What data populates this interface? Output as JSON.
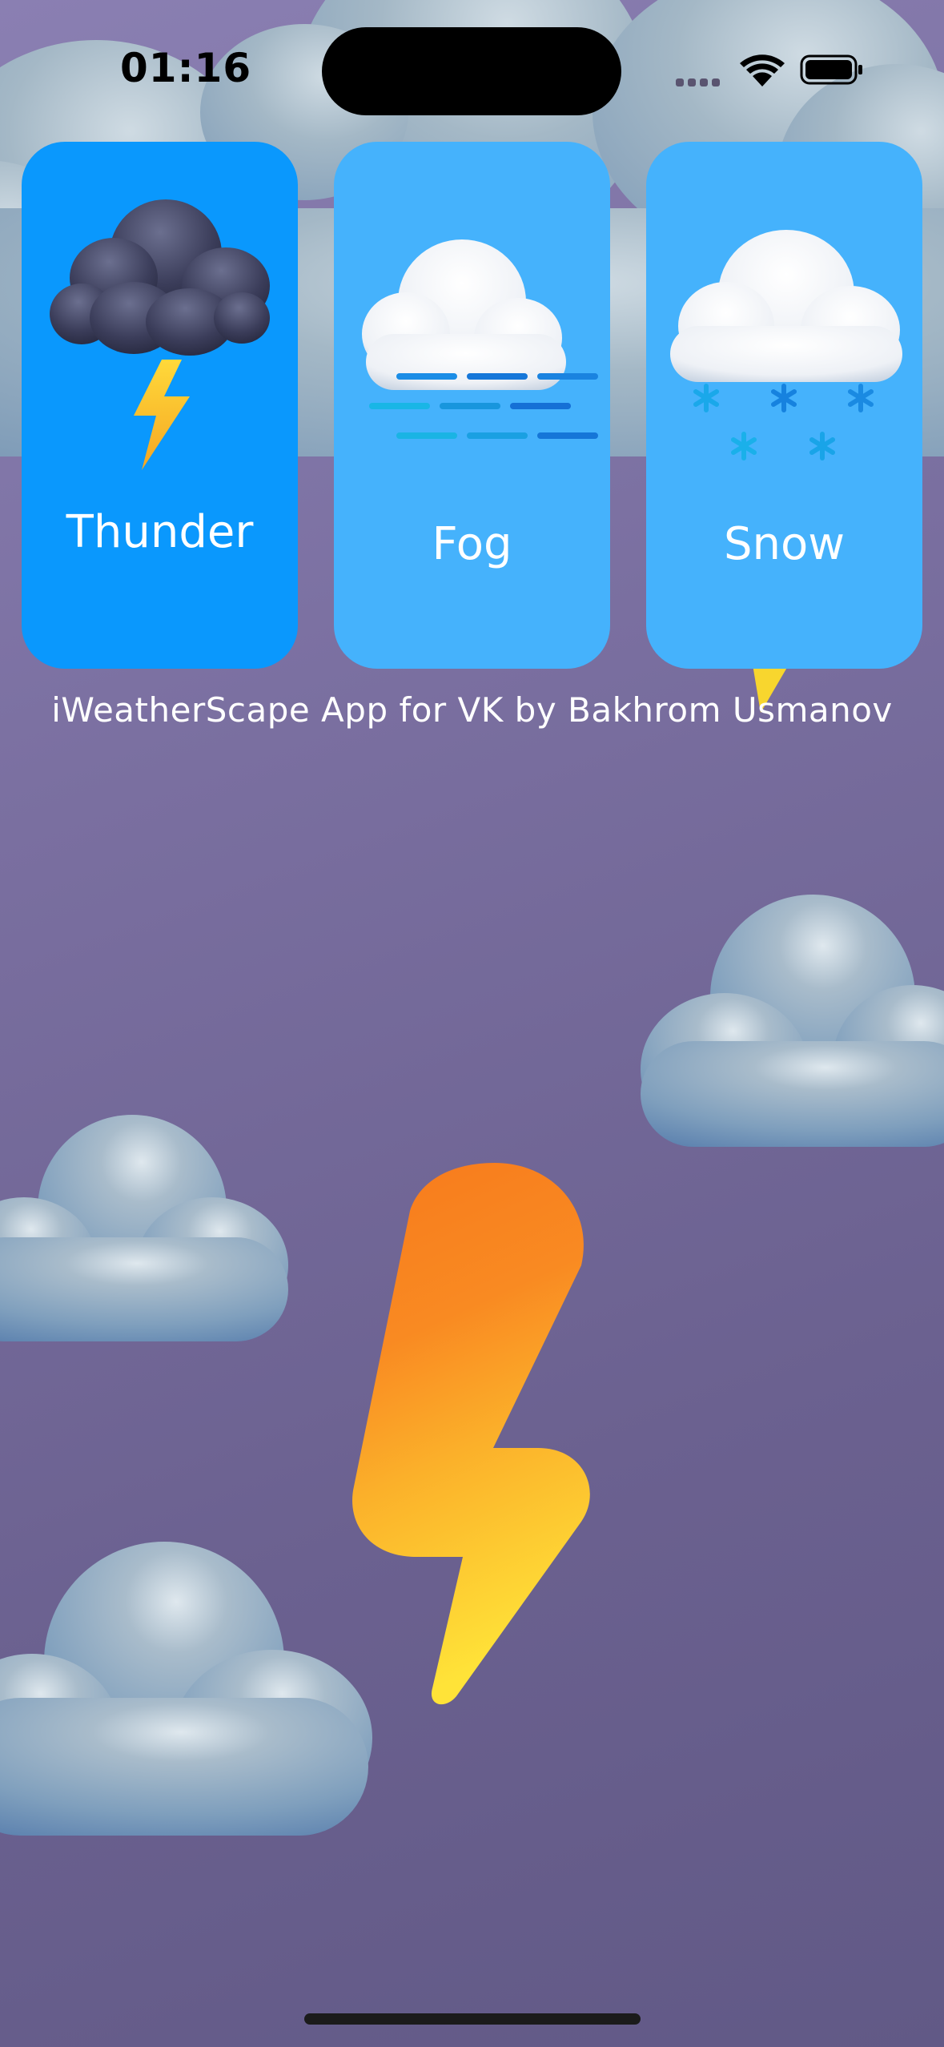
{
  "status_bar": {
    "time": "01:16"
  },
  "weather_cards": [
    {
      "label": "Thunder",
      "icon": "thunderstorm-icon",
      "selected": true
    },
    {
      "label": "Fog",
      "icon": "fog-icon",
      "selected": false
    },
    {
      "label": "Snow",
      "icon": "snow-icon",
      "selected": false
    }
  ],
  "footer": {
    "credit": "iWeatherScape App for VK by Bakhrom Usmanov"
  },
  "colors": {
    "background_top": "#8a7fb2",
    "background_bottom": "#615986",
    "card_selected": "#0a98fd",
    "card_normal": "#45b2fc",
    "bolt_top": "#f77a1c",
    "bolt_bottom": "#ffe338"
  }
}
